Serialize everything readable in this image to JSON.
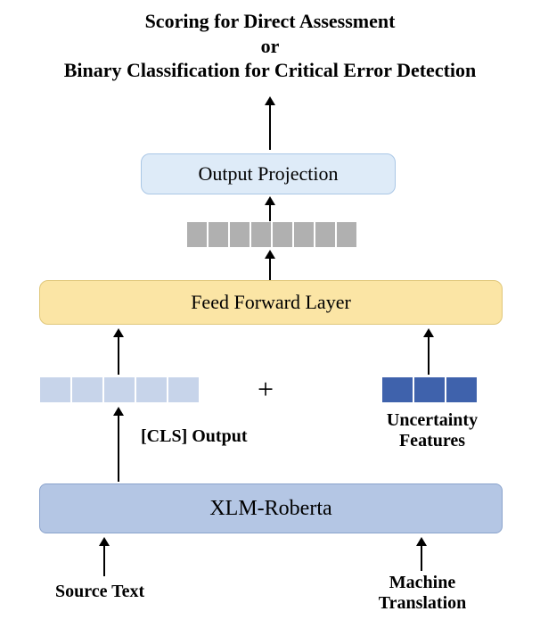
{
  "title": {
    "line1": "Scoring for Direct Assessment",
    "line2": "or",
    "line3": "Binary Classification for Critical Error Detection"
  },
  "boxes": {
    "output_projection": "Output Projection",
    "ffn": "Feed Forward Layer",
    "xlmr": "XLM-Roberta"
  },
  "labels": {
    "plus": "+",
    "cls_output": "[CLS] Output",
    "uncertainty_features_l1": "Uncertainty",
    "uncertainty_features_l2": "Features",
    "source_text": "Source Text",
    "mt_l1": "Machine",
    "mt_l2": "Translation"
  },
  "vectors": {
    "hidden_len": 8,
    "cls_len": 5,
    "unc_len": 3
  },
  "chart_data": {
    "type": "table",
    "title": "Neural architecture diagram",
    "nodes": [
      {
        "id": "source_text",
        "label": "Source Text",
        "kind": "input"
      },
      {
        "id": "machine_translation",
        "label": "Machine Translation",
        "kind": "input"
      },
      {
        "id": "xlm_roberta",
        "label": "XLM-Roberta",
        "kind": "encoder"
      },
      {
        "id": "cls_output",
        "label": "[CLS] Output",
        "kind": "vector",
        "length": 5
      },
      {
        "id": "uncertainty_features",
        "label": "Uncertainty Features",
        "kind": "vector",
        "length": 3
      },
      {
        "id": "concat",
        "label": "+",
        "kind": "concat"
      },
      {
        "id": "feed_forward",
        "label": "Feed Forward Layer",
        "kind": "layer"
      },
      {
        "id": "hidden_vector",
        "label": "",
        "kind": "vector",
        "length": 8
      },
      {
        "id": "output_projection",
        "label": "Output Projection",
        "kind": "layer"
      },
      {
        "id": "task_head",
        "label": "Scoring for Direct Assessment or Binary Classification for Critical Error Detection",
        "kind": "output"
      }
    ],
    "edges": [
      [
        "source_text",
        "xlm_roberta"
      ],
      [
        "machine_translation",
        "xlm_roberta"
      ],
      [
        "xlm_roberta",
        "cls_output"
      ],
      [
        "cls_output",
        "concat"
      ],
      [
        "uncertainty_features",
        "concat"
      ],
      [
        "concat",
        "feed_forward"
      ],
      [
        "feed_forward",
        "hidden_vector"
      ],
      [
        "hidden_vector",
        "output_projection"
      ],
      [
        "output_projection",
        "task_head"
      ]
    ]
  }
}
